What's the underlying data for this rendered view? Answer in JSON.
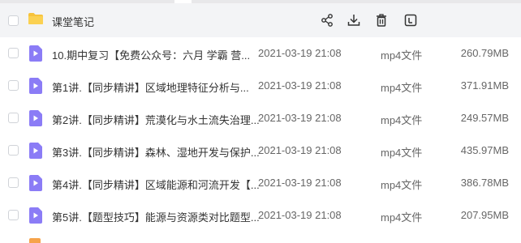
{
  "folder": {
    "name": "课堂笔记",
    "icon": "folder-icon",
    "actions": [
      {
        "name": "share-button",
        "icon": "share-icon"
      },
      {
        "name": "download-button",
        "icon": "download-icon"
      },
      {
        "name": "delete-button",
        "icon": "trash-icon"
      },
      {
        "name": "more-button",
        "icon": "terminal-icon"
      }
    ]
  },
  "colors": {
    "video_icon": "#8b7cf6",
    "folder_icon": "#f7c33c",
    "header_bg": "#f3f4f6"
  },
  "files": [
    {
      "name": "10.期中复习【免费公众号：六月 学霸 营...",
      "date": "2021-03-19 21:08",
      "type": "mp4文件",
      "size": "260.79MB"
    },
    {
      "name": "第1讲.【同步精讲】区域地理特征分析与...",
      "date": "2021-03-19 21:08",
      "type": "mp4文件",
      "size": "371.91MB"
    },
    {
      "name": "第2讲.【同步精讲】荒漠化与水土流失治理...",
      "date": "2021-03-19 21:08",
      "type": "mp4文件",
      "size": "249.57MB"
    },
    {
      "name": "第3讲.【同步精讲】森林、湿地开发与保护...",
      "date": "2021-03-19 21:08",
      "type": "mp4文件",
      "size": "435.97MB"
    },
    {
      "name": "第4讲.【同步精讲】区域能源和河流开发【...",
      "date": "2021-03-19 21:08",
      "type": "mp4文件",
      "size": "386.78MB"
    },
    {
      "name": "第5讲.【题型技巧】能源与资源类对比题型...",
      "date": "2021-03-19 21:08",
      "type": "mp4文件",
      "size": "207.95MB"
    }
  ]
}
